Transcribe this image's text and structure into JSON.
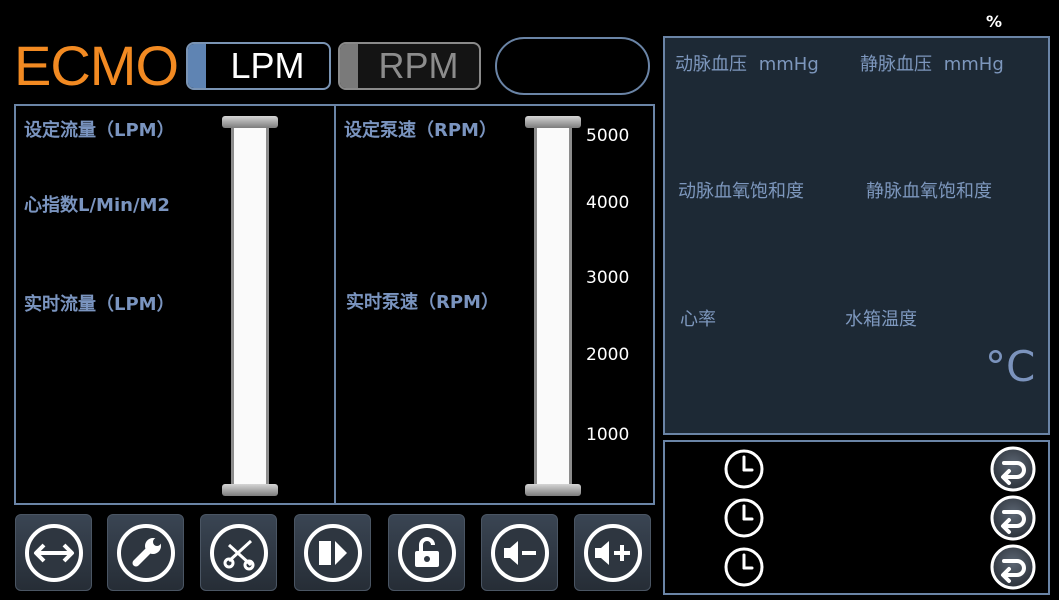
{
  "header": {
    "logo": "ECMO",
    "logo_color": "#f28a22",
    "mode_lpm_label": "LPM",
    "mode_rpm_label": "RPM",
    "percent_symbol": "%"
  },
  "flow_panel": {
    "set_flow_label": "设定流量（LPM）",
    "cardiac_index_label": "心指数L/Min/M2",
    "realtime_flow_label": "实时流量（LPM）"
  },
  "pump_panel": {
    "set_speed_label": "设定泵速（RPM）",
    "realtime_speed_label": "实时泵速（RPM）",
    "scale": [
      "5000",
      "4000",
      "3000",
      "2000",
      "1000"
    ]
  },
  "vitals": {
    "arterial_pressure_label": "动脉血压",
    "arterial_pressure_unit": "mmHg",
    "venous_pressure_label": "静脉血压",
    "venous_pressure_unit": "mmHg",
    "arterial_sat_label": "动脉血氧饱和度",
    "venous_sat_label": "静脉血氧饱和度",
    "heart_rate_label": "心率",
    "water_temp_label": "水箱温度",
    "temp_unit": "°C"
  },
  "timers": [
    {
      "icon": "clock-icon",
      "action_icon": "return-icon"
    },
    {
      "icon": "clock-icon",
      "action_icon": "return-icon"
    },
    {
      "icon": "clock-icon",
      "action_icon": "return-icon"
    }
  ],
  "toolbar": [
    {
      "icon": "double-arrow-icon"
    },
    {
      "icon": "wrench-icon"
    },
    {
      "icon": "scissors-icon"
    },
    {
      "icon": "next-icon"
    },
    {
      "icon": "unlock-icon"
    },
    {
      "icon": "volume-down-icon"
    },
    {
      "icon": "volume-up-icon"
    }
  ]
}
